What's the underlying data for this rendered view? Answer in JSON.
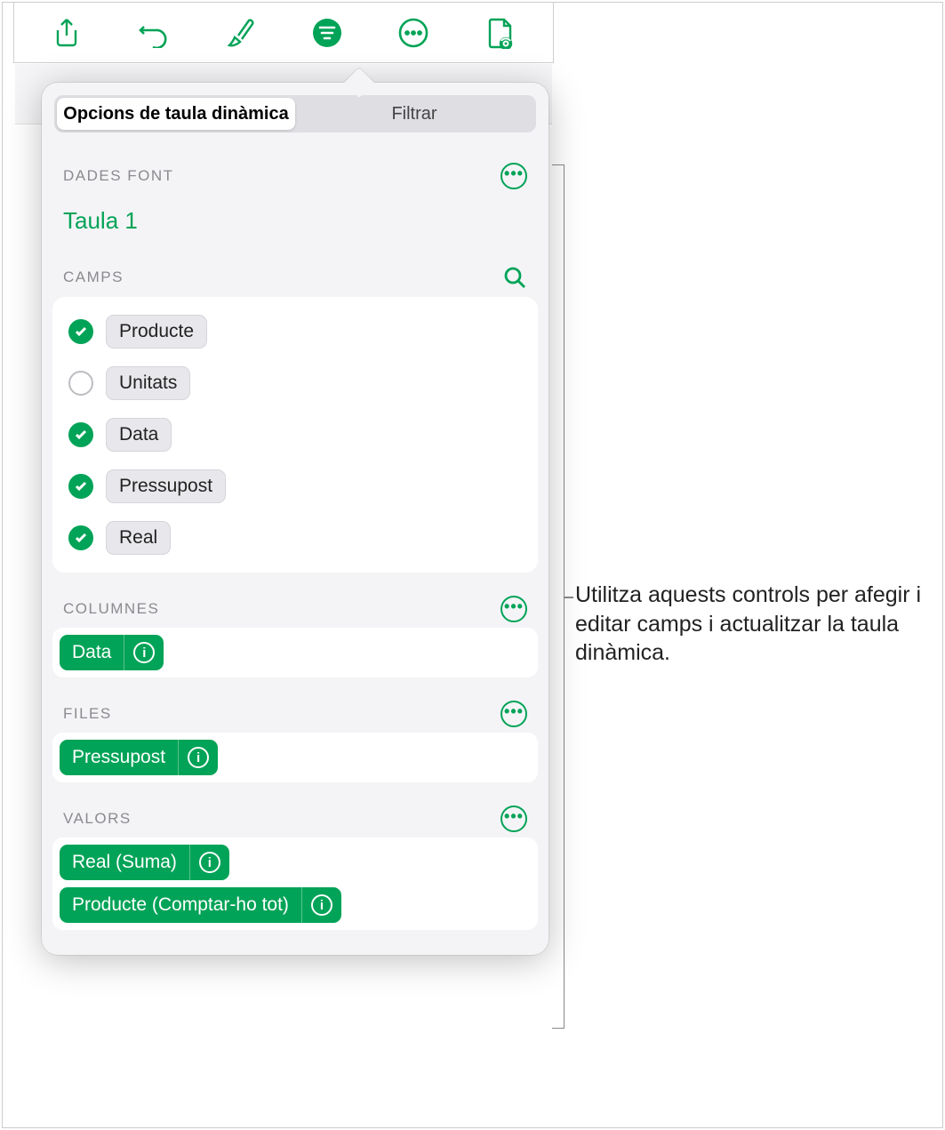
{
  "tabs": {
    "options": "Opcions de taula dinàmica",
    "filter": "Filtrar"
  },
  "source": {
    "heading": "DADES FONT",
    "table": "Taula 1"
  },
  "fields": {
    "heading": "CAMPS",
    "items": [
      {
        "label": "Producte",
        "checked": true
      },
      {
        "label": "Unitats",
        "checked": false
      },
      {
        "label": "Data",
        "checked": true
      },
      {
        "label": "Pressupost",
        "checked": true
      },
      {
        "label": "Real",
        "checked": true
      }
    ]
  },
  "columns": {
    "heading": "COLUMNES",
    "items": [
      {
        "label": "Data"
      }
    ]
  },
  "rows": {
    "heading": "FILES",
    "items": [
      {
        "label": "Pressupost"
      }
    ]
  },
  "values": {
    "heading": "VALORS",
    "items": [
      {
        "label": "Real (Suma)"
      },
      {
        "label": "Producte (Comptar-ho tot)"
      }
    ]
  },
  "callout": "Utilitza aquests controls per afegir i editar camps i actualitzar la taula dinàmica."
}
